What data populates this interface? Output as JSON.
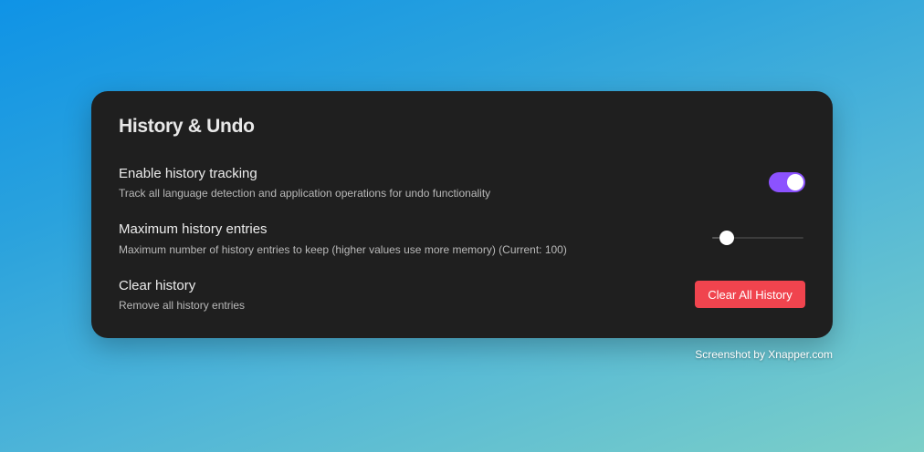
{
  "panel": {
    "title": "History & Undo"
  },
  "settings": [
    {
      "label": "Enable history tracking",
      "description": "Track all language detection and application operations for undo functionality",
      "control": "toggle",
      "enabled": true
    },
    {
      "label": "Maximum history entries",
      "description": "Maximum number of history entries to keep (higher values use more memory) (Current: 100)",
      "control": "slider",
      "value_fraction": 0.16
    },
    {
      "label": "Clear history",
      "description": "Remove all history entries",
      "control": "button",
      "button_label": "Clear All History"
    }
  ],
  "colors": {
    "panel_bg": "#1f1f1f",
    "toggle_on": "#8c52ff",
    "danger_button": "#f0444e"
  },
  "watermark": "Screenshot by Xnapper.com"
}
